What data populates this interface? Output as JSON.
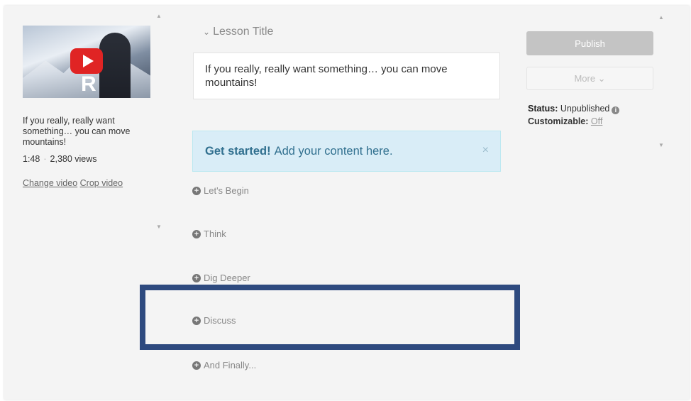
{
  "video": {
    "thumbnail_letter": "R",
    "title": "If you really, really want something… you can move mountains!",
    "duration": "1:48",
    "separator": "·",
    "views": "2,380 views",
    "change_link": "Change video",
    "crop_link": "Crop video"
  },
  "lesson": {
    "label": "Lesson Title",
    "title_value": "If you really, really want something… you can move mountains!"
  },
  "banner": {
    "bold": "Get started!",
    "text": "Add your content here.",
    "close": "×"
  },
  "sections": [
    {
      "label": "Let's Begin"
    },
    {
      "label": "Think"
    },
    {
      "label": "Dig Deeper"
    },
    {
      "label": "Discuss"
    },
    {
      "label": "And Finally..."
    }
  ],
  "sidebar": {
    "publish_label": "Publish",
    "more_label": "More ⌄",
    "status_key": "Status:",
    "status_value": "Unpublished",
    "customizable_key": "Customizable:",
    "customizable_value": "Off"
  },
  "colors": {
    "highlight": "#2e4a7f",
    "banner_bg": "#d9edf7",
    "banner_text": "#31708f",
    "publish_bg": "#c4c4c4"
  }
}
